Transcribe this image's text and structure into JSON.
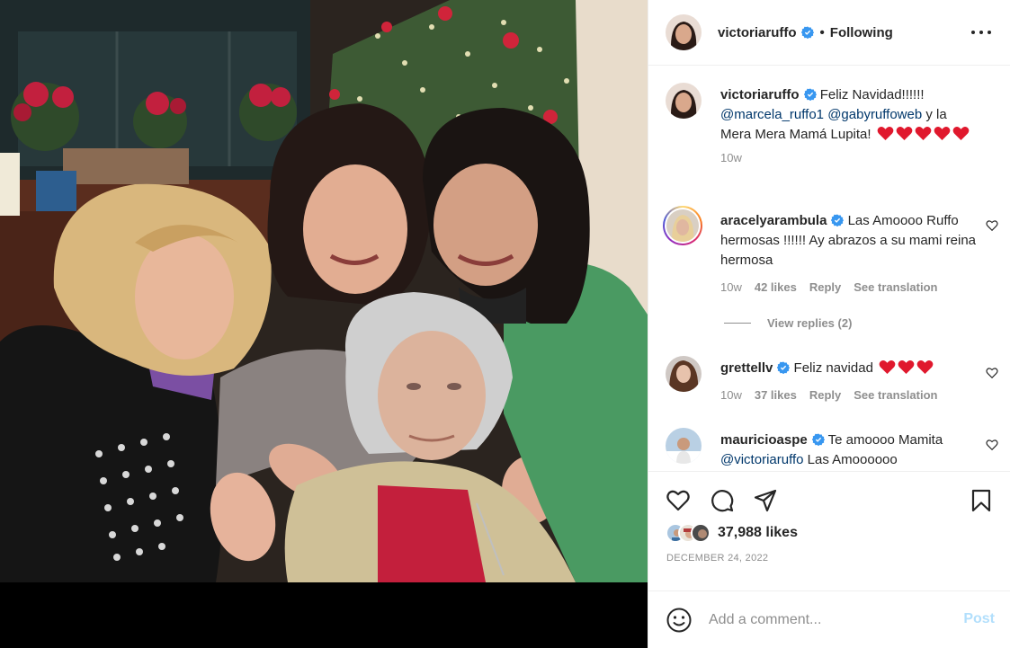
{
  "post": {
    "author": "victoriaruffo",
    "follow_state": "Following",
    "likes": "37,988 likes",
    "date": "DECEMBER 24, 2022"
  },
  "caption": {
    "username": "victoriaruffo",
    "text_pre": "Feliz Navidad!!!!!!",
    "mention_1": "@marcela_ruffo1",
    "mention_2": "@gabyruffoweb",
    "text_post": "y la Mera Mera Mamá Lupita!",
    "time": "10w"
  },
  "comments": [
    {
      "username": "aracelyarambula",
      "text": "Las Amoooo Ruffo hermosas !!!!!! Ay abrazos a su mami reina hermosa",
      "time": "10w",
      "likes": "42 likes",
      "reply": "Reply",
      "translate": "See translation",
      "view_replies": "View replies (2)"
    },
    {
      "username": "grettellv",
      "text": "Feliz navidad",
      "time": "10w",
      "likes": "37 likes",
      "reply": "Reply",
      "translate": "See translation"
    },
    {
      "username": "mauricioaspe",
      "text": "Te amoooo Mamita",
      "mention": "@victoriaruffo",
      "text_post": "Las Amoooooo"
    }
  ],
  "composer": {
    "placeholder": "Add a comment...",
    "post_label": "Post"
  },
  "colors": {
    "accent_blue": "#0095f6",
    "post_disabled": "#b2dffc",
    "mention": "#00376b",
    "heart_red": "#e0182d",
    "verified_blue": "#3897f0"
  },
  "icons": [
    "more-options-icon",
    "verified-icon",
    "like-icon",
    "comment-icon",
    "share-icon",
    "save-icon",
    "emoji-icon",
    "heart-emoji"
  ]
}
